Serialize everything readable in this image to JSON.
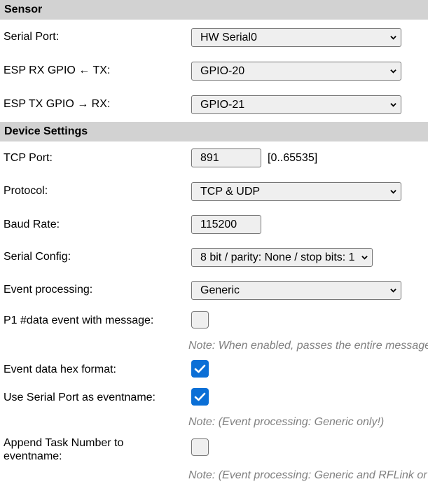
{
  "sections": {
    "sensor": "Sensor",
    "device": "Device Settings"
  },
  "sensor": {
    "serial_port": {
      "label": "Serial Port:",
      "value": "HW Serial0"
    },
    "rx_gpio": {
      "label": "ESP RX GPIO ← TX:",
      "value": "GPIO-20"
    },
    "tx_gpio": {
      "label": "ESP TX GPIO → RX:",
      "value": "GPIO-21"
    }
  },
  "device": {
    "tcp_port": {
      "label": "TCP Port:",
      "value": "891",
      "range": "[0..65535]"
    },
    "protocol": {
      "label": "Protocol:",
      "value": "TCP & UDP"
    },
    "baud_rate": {
      "label": "Baud Rate:",
      "value": "115200"
    },
    "serial_config": {
      "label": "Serial Config:",
      "value": "8 bit / parity: None / stop bits: 1"
    },
    "event_processing": {
      "label": "Event processing:",
      "value": "Generic"
    },
    "p1_data_event": {
      "label": "P1 #data event with message:",
      "checked": false
    },
    "note_p1": "Note: When enabled, passes the entire message",
    "hex_format": {
      "label": "Event data hex format:",
      "checked": true
    },
    "serial_eventname": {
      "label": "Use Serial Port as eventname:",
      "checked": true
    },
    "note_generic": "Note: (Event processing: Generic only!)",
    "append_task": {
      "label": "Append Task Number to eventname:",
      "checked": false
    },
    "note_rflink": "Note: (Event processing: Generic and RFLink or"
  },
  "colors": {
    "header_bg": "#d2d2d2",
    "checkbox_on": "#0b6fd6",
    "note": "#808080"
  }
}
